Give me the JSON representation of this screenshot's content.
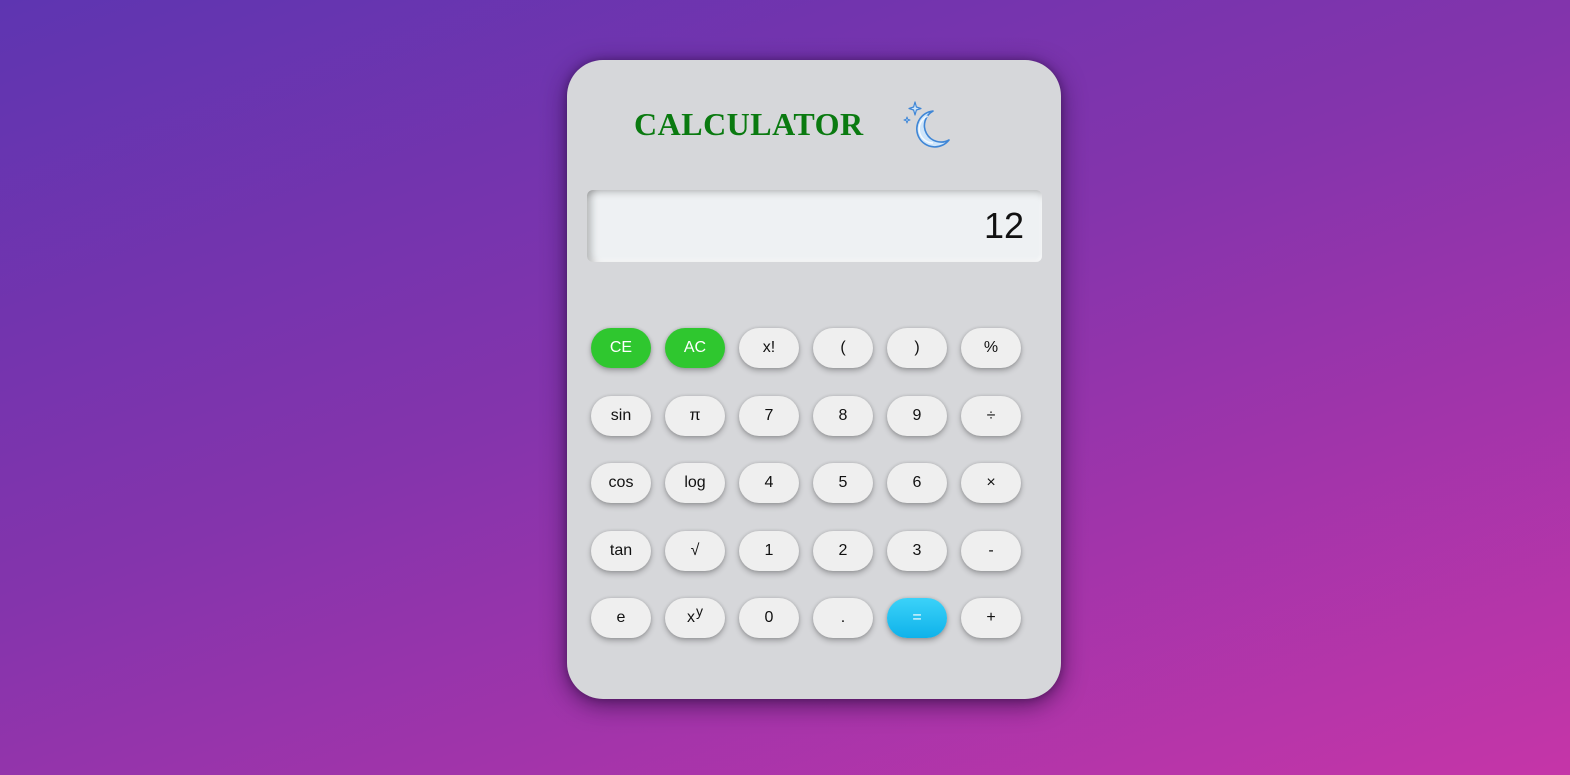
{
  "app": {
    "title": "CALCULATOR",
    "theme_icon": "crescent-moon-stars-icon"
  },
  "display": {
    "value": "12"
  },
  "keypad": {
    "rows": [
      [
        {
          "label": "CE",
          "style": "green"
        },
        {
          "label": "AC",
          "style": "green"
        },
        {
          "label": "x!",
          "style": "normal"
        },
        {
          "label": "(",
          "style": "normal"
        },
        {
          "label": ")",
          "style": "normal"
        },
        {
          "label": "%",
          "style": "normal"
        }
      ],
      [
        {
          "label": "sin",
          "style": "normal"
        },
        {
          "label": "π",
          "style": "normal"
        },
        {
          "label": "7",
          "style": "normal"
        },
        {
          "label": "8",
          "style": "normal"
        },
        {
          "label": "9",
          "style": "normal"
        },
        {
          "label": "÷",
          "style": "normal"
        }
      ],
      [
        {
          "label": "cos",
          "style": "normal"
        },
        {
          "label": "log",
          "style": "normal"
        },
        {
          "label": "4",
          "style": "normal"
        },
        {
          "label": "5",
          "style": "normal"
        },
        {
          "label": "6",
          "style": "normal"
        },
        {
          "label": "×",
          "style": "normal"
        }
      ],
      [
        {
          "label": "tan",
          "style": "normal"
        },
        {
          "label": "√",
          "style": "normal"
        },
        {
          "label": "1",
          "style": "normal"
        },
        {
          "label": "2",
          "style": "normal"
        },
        {
          "label": "3",
          "style": "normal"
        },
        {
          "label": "-",
          "style": "normal"
        }
      ],
      [
        {
          "label": "e",
          "style": "normal"
        },
        {
          "label": "x",
          "sup": "y",
          "style": "normal"
        },
        {
          "label": "0",
          "style": "normal"
        },
        {
          "label": ".",
          "style": "normal"
        },
        {
          "label": "=",
          "style": "blue"
        },
        {
          "label": "+",
          "style": "normal"
        }
      ]
    ]
  },
  "colors": {
    "background_start": "#5e35b1",
    "background_end": "#c535a8",
    "panel": "#d6d7da",
    "title": "#0a7a10",
    "clear_keys": "#2fc72f",
    "equals_key": "#1ec0f2",
    "key": "#efefef"
  }
}
